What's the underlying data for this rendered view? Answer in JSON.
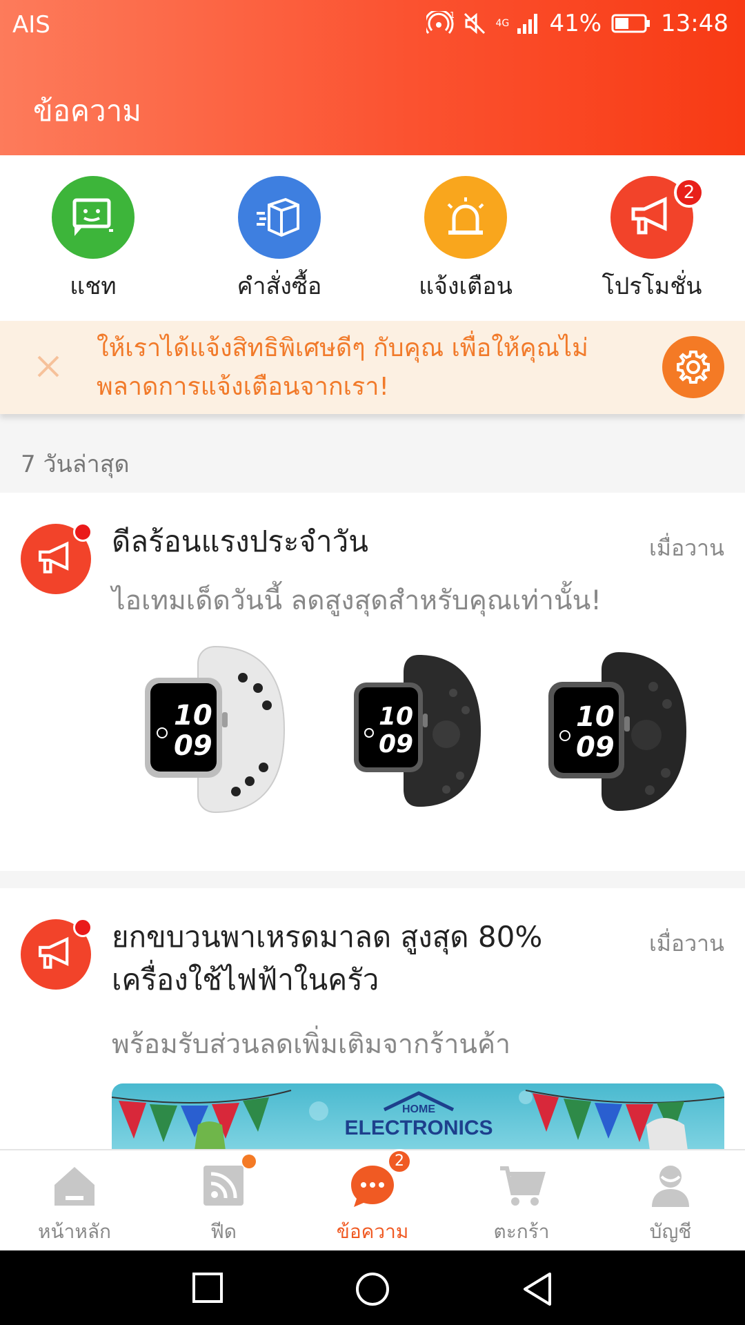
{
  "status_bar": {
    "carrier": "AIS",
    "network": "4G",
    "battery_percent": "41%",
    "time": "13:48"
  },
  "header": {
    "title": "ข้อความ"
  },
  "categories": [
    {
      "label": "แชท",
      "icon": "chat-icon",
      "color": "#3db53a"
    },
    {
      "label": "คำสั่งซื้อ",
      "icon": "box-icon",
      "color": "#3e7fe0"
    },
    {
      "label": "แจ้งเตือน",
      "icon": "alarm-icon",
      "color": "#f9a61d"
    },
    {
      "label": "โปรโมชั่น",
      "icon": "megaphone-icon",
      "color": "#f2432a",
      "badge": "2"
    }
  ],
  "banner": {
    "text": "ให้เราได้แจ้งสิทธิพิเศษดีๆ กับคุณ เพื่อให้คุณไม่พลาดการแจ้งเตือนจากเรา!"
  },
  "section_label": "7 วันล่าสุด",
  "notifications": [
    {
      "title": "ดีลร้อนแรงประจำวัน",
      "time": "เมื่อวาน",
      "subtitle": "ไอเทมเด็ดวันนี้ ลดสูงสุดสำหรับคุณเท่านั้น!"
    },
    {
      "title": "ยกขบวนพาเหรดมาลด สูงสุด 80% เครื่องใช้ไฟฟ้าในครัว",
      "time": "เมื่อวาน",
      "subtitle": "พร้อมรับส่วนลดเพิ่มเติมจากร้านค้า",
      "promo_logo_top": "HOME",
      "promo_logo_main": "ELECTRONICS"
    }
  ],
  "watch_face": {
    "hour": "10",
    "minute": "09"
  },
  "bottom_nav": [
    {
      "label": "หน้าหลัก",
      "icon": "home-icon"
    },
    {
      "label": "ฟีด",
      "icon": "feed-icon"
    },
    {
      "label": "ข้อความ",
      "icon": "message-icon",
      "active": true,
      "badge": "2"
    },
    {
      "label": "ตะกร้า",
      "icon": "cart-icon"
    },
    {
      "label": "บัญชี",
      "icon": "account-icon"
    }
  ],
  "colors": {
    "accent": "#f05a23",
    "header_start": "#fd7b5b",
    "header_end": "#f83a14"
  }
}
